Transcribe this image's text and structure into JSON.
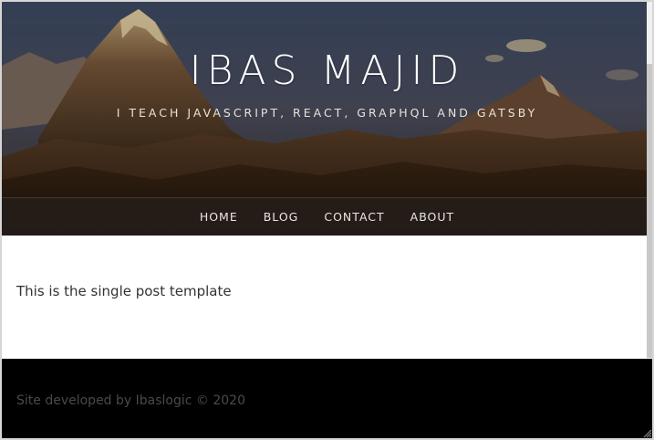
{
  "site": {
    "title": "IBAS MAJID",
    "tagline": "I TEACH JAVASCRIPT, REACT, GRAPHQL AND GATSBY"
  },
  "nav": {
    "items": [
      {
        "label": "HOME"
      },
      {
        "label": "BLOG"
      },
      {
        "label": "CONTACT"
      },
      {
        "label": "ABOUT"
      }
    ]
  },
  "main": {
    "post_text": "This is the single post template"
  },
  "footer": {
    "text": "Site developed by Ibaslogic © 2020"
  },
  "colors": {
    "footer_bg": "#000000",
    "nav_bg": "#261f1b",
    "title_color": "#ffffff"
  },
  "icons": {
    "resize": "resize-grip-icon"
  }
}
